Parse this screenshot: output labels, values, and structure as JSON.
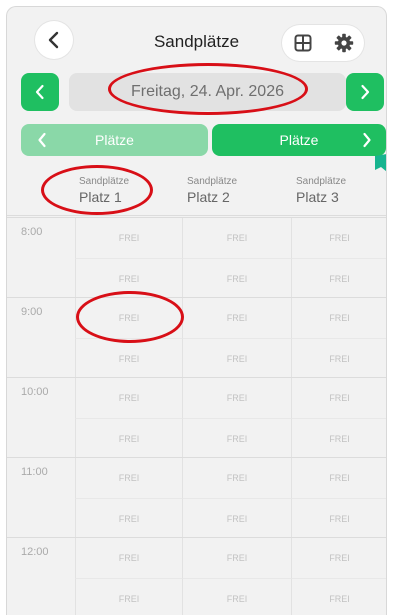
{
  "header": {
    "title": "Sandplätze",
    "back_icon": "chevron-left-icon",
    "grid_icon": "grid-view-icon",
    "settings_icon": "gear-icon"
  },
  "date_nav": {
    "date": "Freitag, 24. Apr. 2026",
    "prev_icon": "chevron-left-icon",
    "next_icon": "chevron-right-icon"
  },
  "court_nav": {
    "prev_label": "Plätze",
    "next_label": "Plätze"
  },
  "columns": [
    {
      "category": "Sandplätze",
      "name": "Platz 1"
    },
    {
      "category": "Sandplätze",
      "name": "Platz 2"
    },
    {
      "category": "Sandplätze",
      "name": "Platz 3"
    }
  ],
  "hours": [
    "8:00",
    "9:00",
    "10:00",
    "11:00",
    "12:00"
  ],
  "slot_label": "FREI",
  "colors": {
    "accent": "#1fbf61",
    "accent_light": "#8ad8a8",
    "annotation": "#d80f17"
  }
}
